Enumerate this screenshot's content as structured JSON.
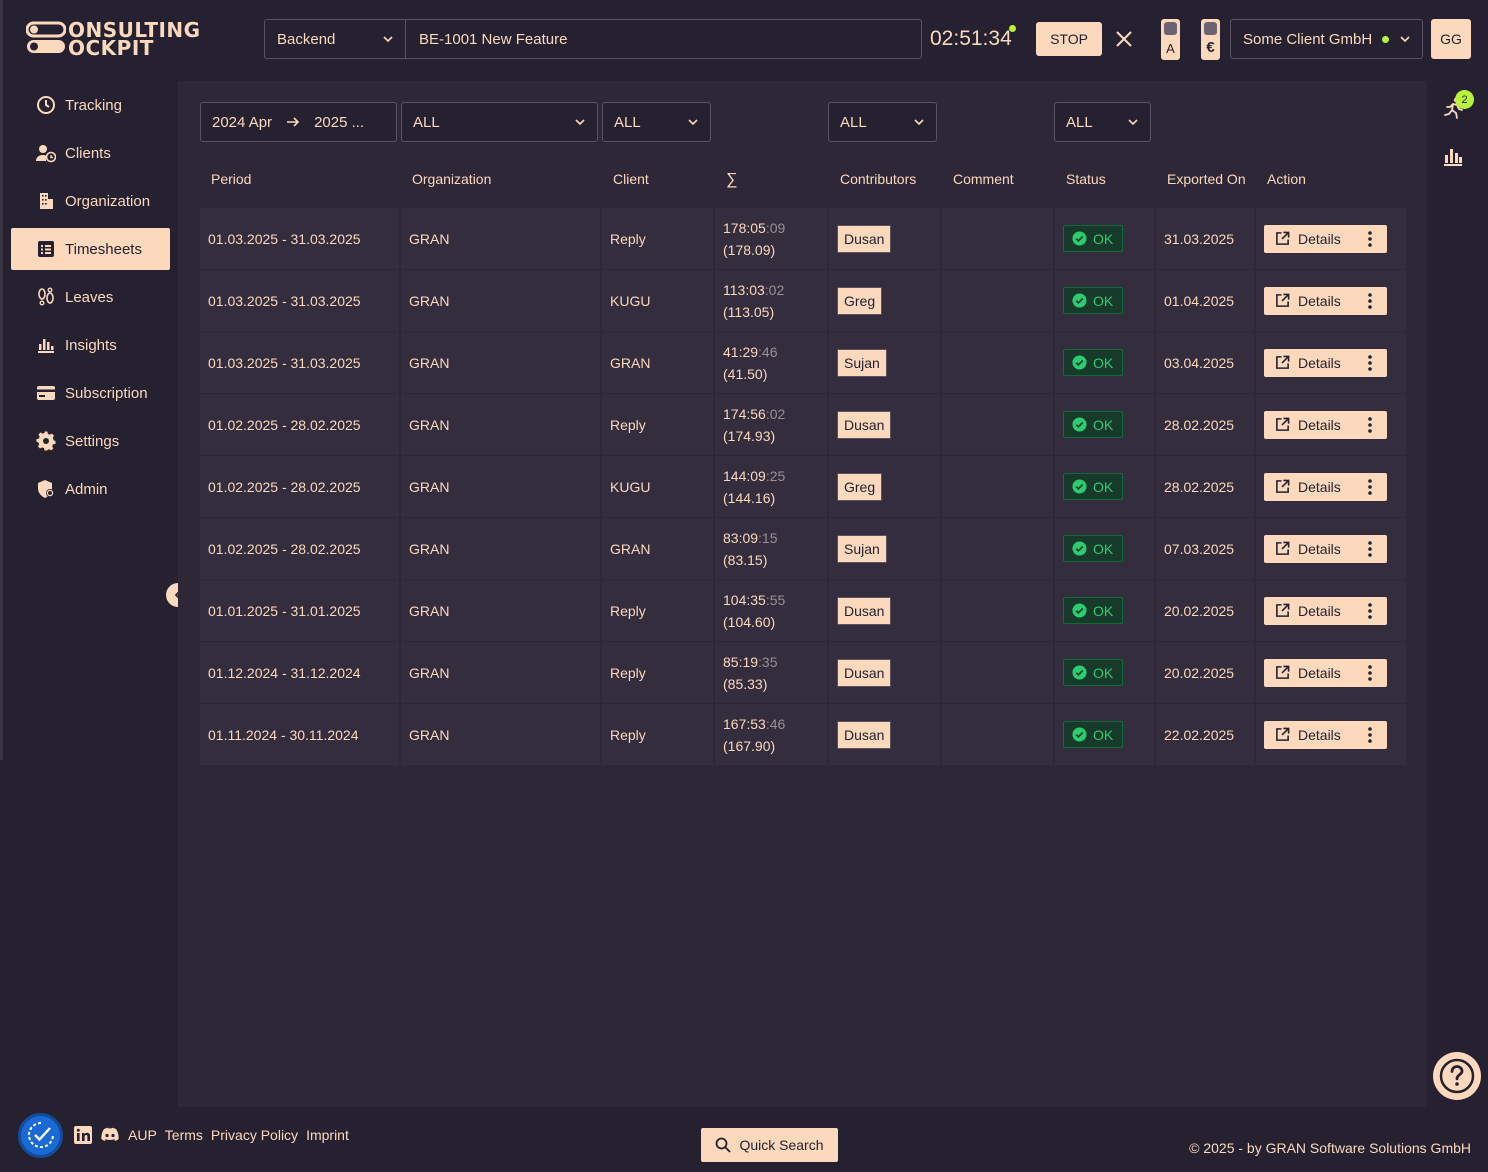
{
  "brand": {
    "line1": "ONSULTING",
    "line2": "OCKPIT"
  },
  "tracker": {
    "project": "Backend",
    "task": "BE-1001 New Feature",
    "time": "02:51:34",
    "stop_label": "STOP",
    "toggle_a": "A",
    "toggle_b": "€",
    "client": "Some Client GmbH",
    "avatar": "GG"
  },
  "sidebar": {
    "items": [
      {
        "label": "Tracking",
        "icon": "clock-icon"
      },
      {
        "label": "Clients",
        "icon": "user-clock-icon"
      },
      {
        "label": "Organization",
        "icon": "building-icon"
      },
      {
        "label": "Timesheets",
        "icon": "list-icon",
        "active": true
      },
      {
        "label": "Leaves",
        "icon": "footprints-icon"
      },
      {
        "label": "Insights",
        "icon": "bar-chart-icon"
      },
      {
        "label": "Subscription",
        "icon": "credit-card-icon"
      },
      {
        "label": "Settings",
        "icon": "gear-icon"
      },
      {
        "label": "Admin",
        "icon": "shield-icon"
      }
    ]
  },
  "filters": {
    "date_from": "2024 Apr",
    "date_to": "2025 ...",
    "organization": "ALL",
    "client": "ALL",
    "contributors": "ALL",
    "status": "ALL"
  },
  "table": {
    "headers": {
      "period": "Period",
      "organization": "Organization",
      "client": "Client",
      "sum": "∑",
      "contributors": "Contributors",
      "comment": "Comment",
      "status": "Status",
      "exported_on": "Exported On",
      "action": "Action"
    },
    "details_label": "Details",
    "rows": [
      {
        "period": "01.03.2025 - 31.03.2025",
        "organization": "GRAN",
        "client": "Reply",
        "hm": "178:05",
        "sec": ":09",
        "dec": "(178.09)",
        "contributor": "Dusan",
        "comment": "",
        "status": "OK",
        "exported": "31.03.2025"
      },
      {
        "period": "01.03.2025 - 31.03.2025",
        "organization": "GRAN",
        "client": "KUGU",
        "hm": "113:03",
        "sec": ":02",
        "dec": "(113.05)",
        "contributor": "Greg",
        "comment": "",
        "status": "OK",
        "exported": "01.04.2025"
      },
      {
        "period": "01.03.2025 - 31.03.2025",
        "organization": "GRAN",
        "client": "GRAN",
        "hm": "41:29",
        "sec": ":46",
        "dec": "(41.50)",
        "contributor": "Sujan",
        "comment": "",
        "status": "OK",
        "exported": "03.04.2025"
      },
      {
        "period": "01.02.2025 - 28.02.2025",
        "organization": "GRAN",
        "client": "Reply",
        "hm": "174:56",
        "sec": ":02",
        "dec": "(174.93)",
        "contributor": "Dusan",
        "comment": "",
        "status": "OK",
        "exported": "28.02.2025"
      },
      {
        "period": "01.02.2025 - 28.02.2025",
        "organization": "GRAN",
        "client": "KUGU",
        "hm": "144:09",
        "sec": ":25",
        "dec": "(144.16)",
        "contributor": "Greg",
        "comment": "",
        "status": "OK",
        "exported": "28.02.2025"
      },
      {
        "period": "01.02.2025 - 28.02.2025",
        "organization": "GRAN",
        "client": "GRAN",
        "hm": "83:09",
        "sec": ":15",
        "dec": "(83.15)",
        "contributor": "Sujan",
        "comment": "",
        "status": "OK",
        "exported": "07.03.2025"
      },
      {
        "period": "01.01.2025 - 31.01.2025",
        "organization": "GRAN",
        "client": "Reply",
        "hm": "104:35",
        "sec": ":55",
        "dec": "(104.60)",
        "contributor": "Dusan",
        "comment": "",
        "status": "OK",
        "exported": "20.02.2025"
      },
      {
        "period": "01.12.2024 - 31.12.2024",
        "organization": "GRAN",
        "client": "Reply",
        "hm": "85:19",
        "sec": ":35",
        "dec": "(85.33)",
        "contributor": "Dusan",
        "comment": "",
        "status": "OK",
        "exported": "20.02.2025"
      },
      {
        "period": "01.11.2024 - 30.11.2024",
        "organization": "GRAN",
        "client": "Reply",
        "hm": "167:53",
        "sec": ":46",
        "dec": "(167.90)",
        "contributor": "Dusan",
        "comment": "",
        "status": "OK",
        "exported": "22.02.2025"
      }
    ]
  },
  "rail": {
    "badge_count": "2"
  },
  "footer": {
    "links": [
      "AUP",
      "Terms",
      "Privacy Policy",
      "Imprint"
    ],
    "quick_search": "Quick Search",
    "copyright": "© 2025 - by GRAN Software Solutions GmbH"
  },
  "colors": {
    "accent": "#fcd9bd",
    "background": "#262130",
    "panel": "#2d2737",
    "ok": "#2ecc71",
    "live": "#b8f53a"
  }
}
